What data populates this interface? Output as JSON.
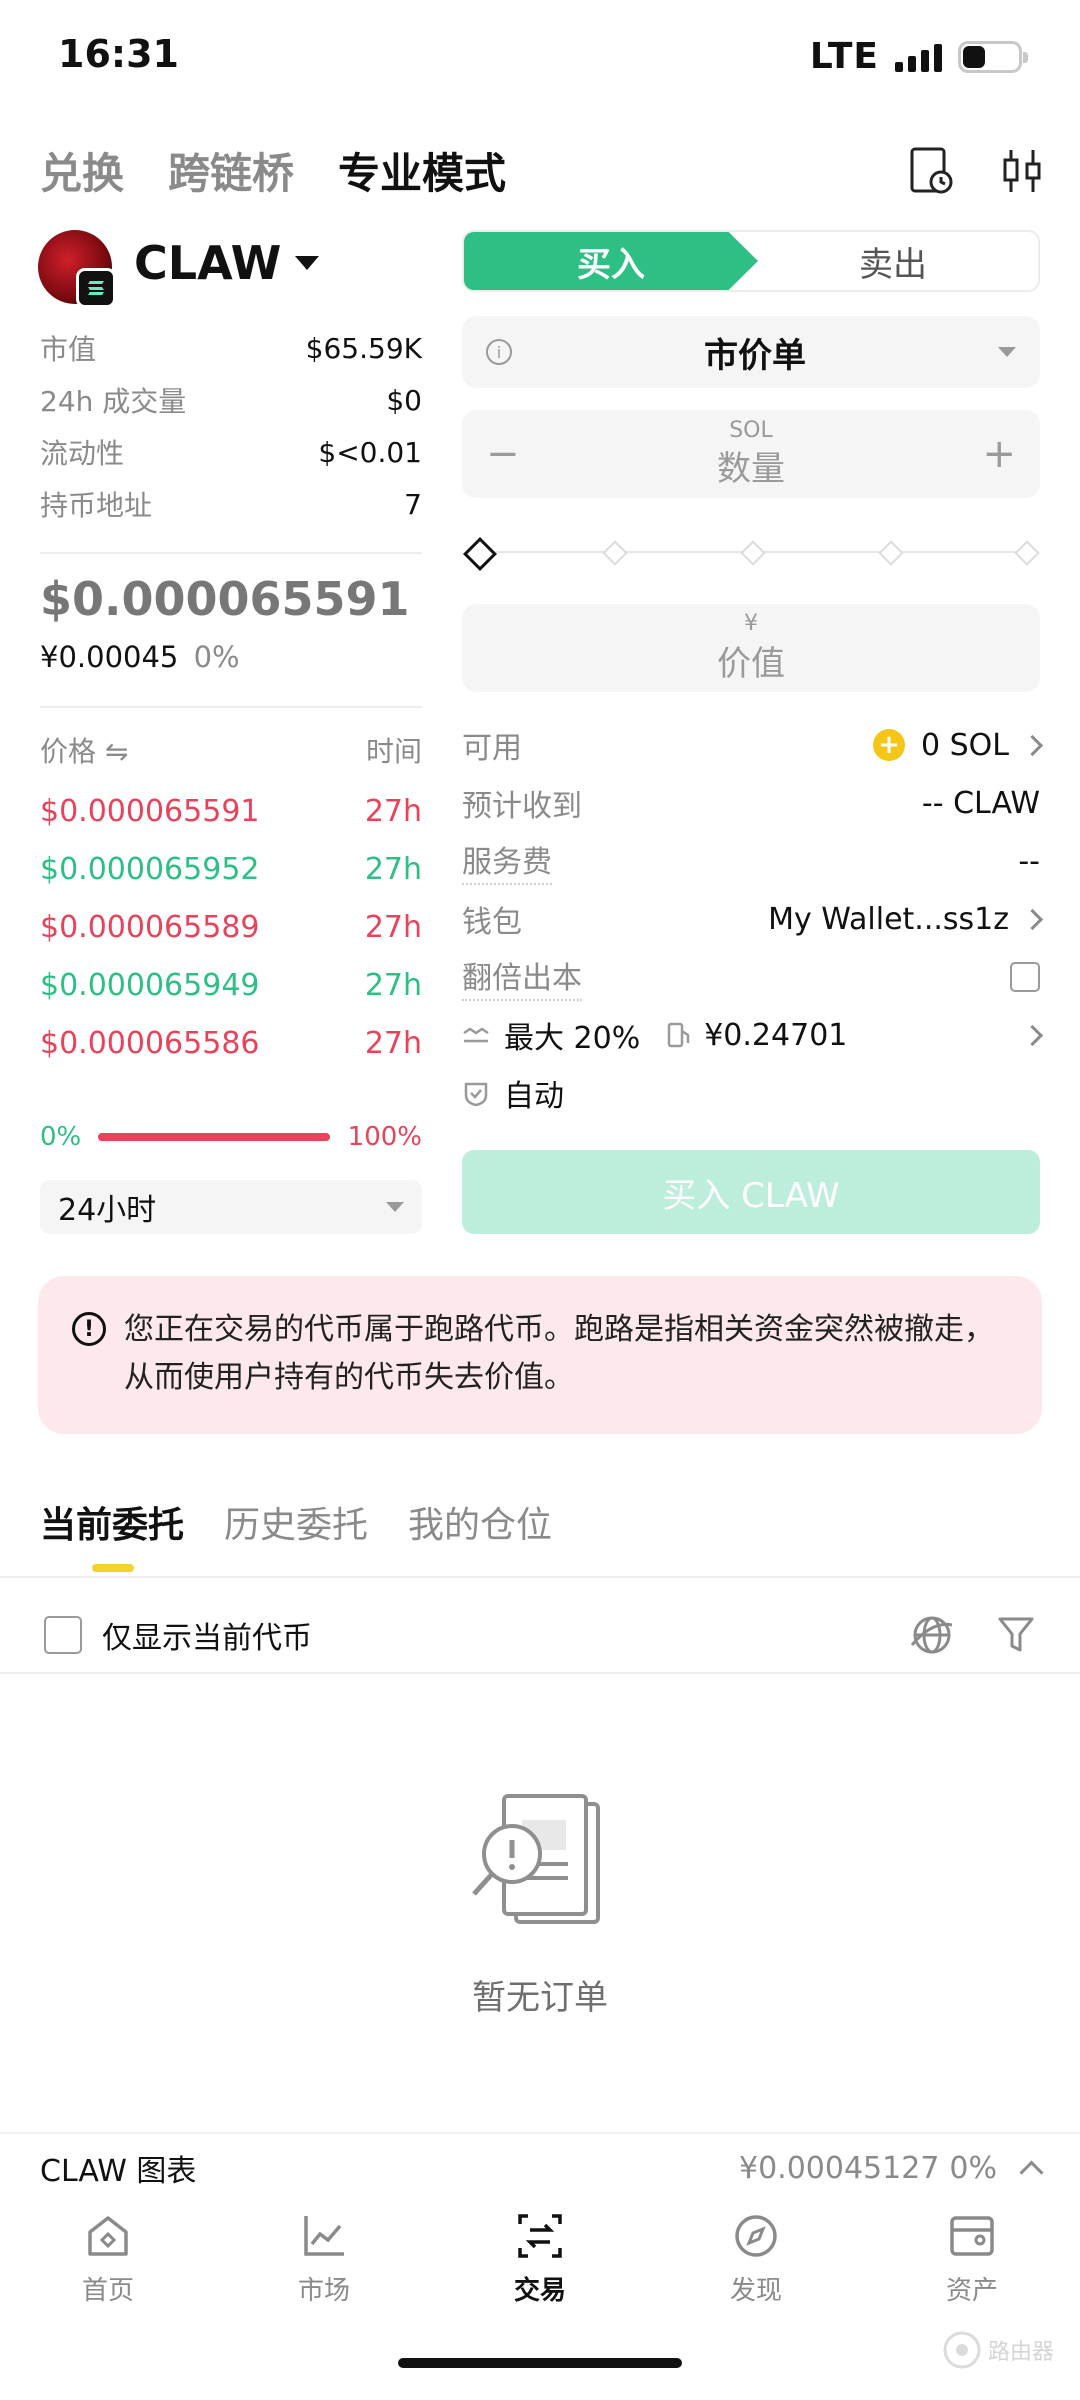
{
  "status_bar": {
    "time": "16:31",
    "network": "LTE"
  },
  "top_nav": {
    "tabs": [
      "兑换",
      "跨链桥",
      "专业模式"
    ],
    "active_index": 2
  },
  "token": {
    "name": "CLAW",
    "stats": [
      {
        "label": "市值",
        "value": "$65.59K"
      },
      {
        "label": "24h 成交量",
        "value": "$0"
      },
      {
        "label": "流动性",
        "value": "$<0.01"
      },
      {
        "label": "持币地址",
        "value": "7"
      }
    ],
    "price_usd": "$0.000065591",
    "price_cny": "¥0.00045",
    "change": "0%"
  },
  "trades": {
    "price_header": "价格 ⇋",
    "time_header": "时间",
    "rows": [
      {
        "price": "$0.000065591",
        "time": "27h",
        "side": "sell"
      },
      {
        "price": "$0.000065952",
        "time": "27h",
        "side": "buy"
      },
      {
        "price": "$0.000065589",
        "time": "27h",
        "side": "sell"
      },
      {
        "price": "$0.000065949",
        "time": "27h",
        "side": "buy"
      },
      {
        "price": "$0.000065586",
        "time": "27h",
        "side": "sell"
      }
    ]
  },
  "ratio": {
    "left": "0%",
    "right": "100%",
    "sell_fraction": 1.0
  },
  "range_select": {
    "value": "24小时"
  },
  "order_form": {
    "buy_label": "买入",
    "sell_label": "卖出",
    "order_type": "市价单",
    "quantity": {
      "unit": "SOL",
      "placeholder": "数量",
      "minus": "−",
      "plus": "+"
    },
    "value_field": {
      "unit": "¥",
      "placeholder": "价值"
    },
    "available": {
      "label": "可用",
      "value": "0 SOL"
    },
    "expected": {
      "label": "预计收到",
      "value": "-- CLAW"
    },
    "fee": {
      "label": "服务费",
      "value": "--"
    },
    "wallet": {
      "label": "钱包",
      "value": "My Wallet...ss1z"
    },
    "double_cost": {
      "label": "翻倍出本",
      "checked": false
    },
    "slippage": {
      "value": "最大 20%",
      "gas": "¥0.24701"
    },
    "auto": {
      "label": "自动"
    },
    "submit_label": "买入 CLAW"
  },
  "warning": {
    "text": "您正在交易的代币属于跑路代币。跑路是指相关资金突然被撤走，从而使用户持有的代币失去价值。"
  },
  "orders": {
    "tabs": [
      "当前委托",
      "历史委托",
      "我的仓位"
    ],
    "active_index": 0,
    "only_current_label": "仅显示当前代币",
    "empty_text": "暂无订单"
  },
  "chart_bar": {
    "label": "CLAW 图表",
    "price": "¥0.00045127",
    "change": "0%"
  },
  "bottom_nav": [
    {
      "label": "首页",
      "icon": "home-icon",
      "active": false
    },
    {
      "label": "市场",
      "icon": "market-chart-icon",
      "active": false
    },
    {
      "label": "交易",
      "icon": "trade-swap-icon",
      "active": true
    },
    {
      "label": "发现",
      "icon": "discover-compass-icon",
      "active": false
    },
    {
      "label": "资产",
      "icon": "wallet-icon",
      "active": false
    }
  ],
  "watermark": "路由器",
  "colors": {
    "buy_green": "#2dbf83",
    "sell_red": "#e8435a",
    "warning_bg": "#fde9ec",
    "tab_underline": "#f5d32a"
  }
}
